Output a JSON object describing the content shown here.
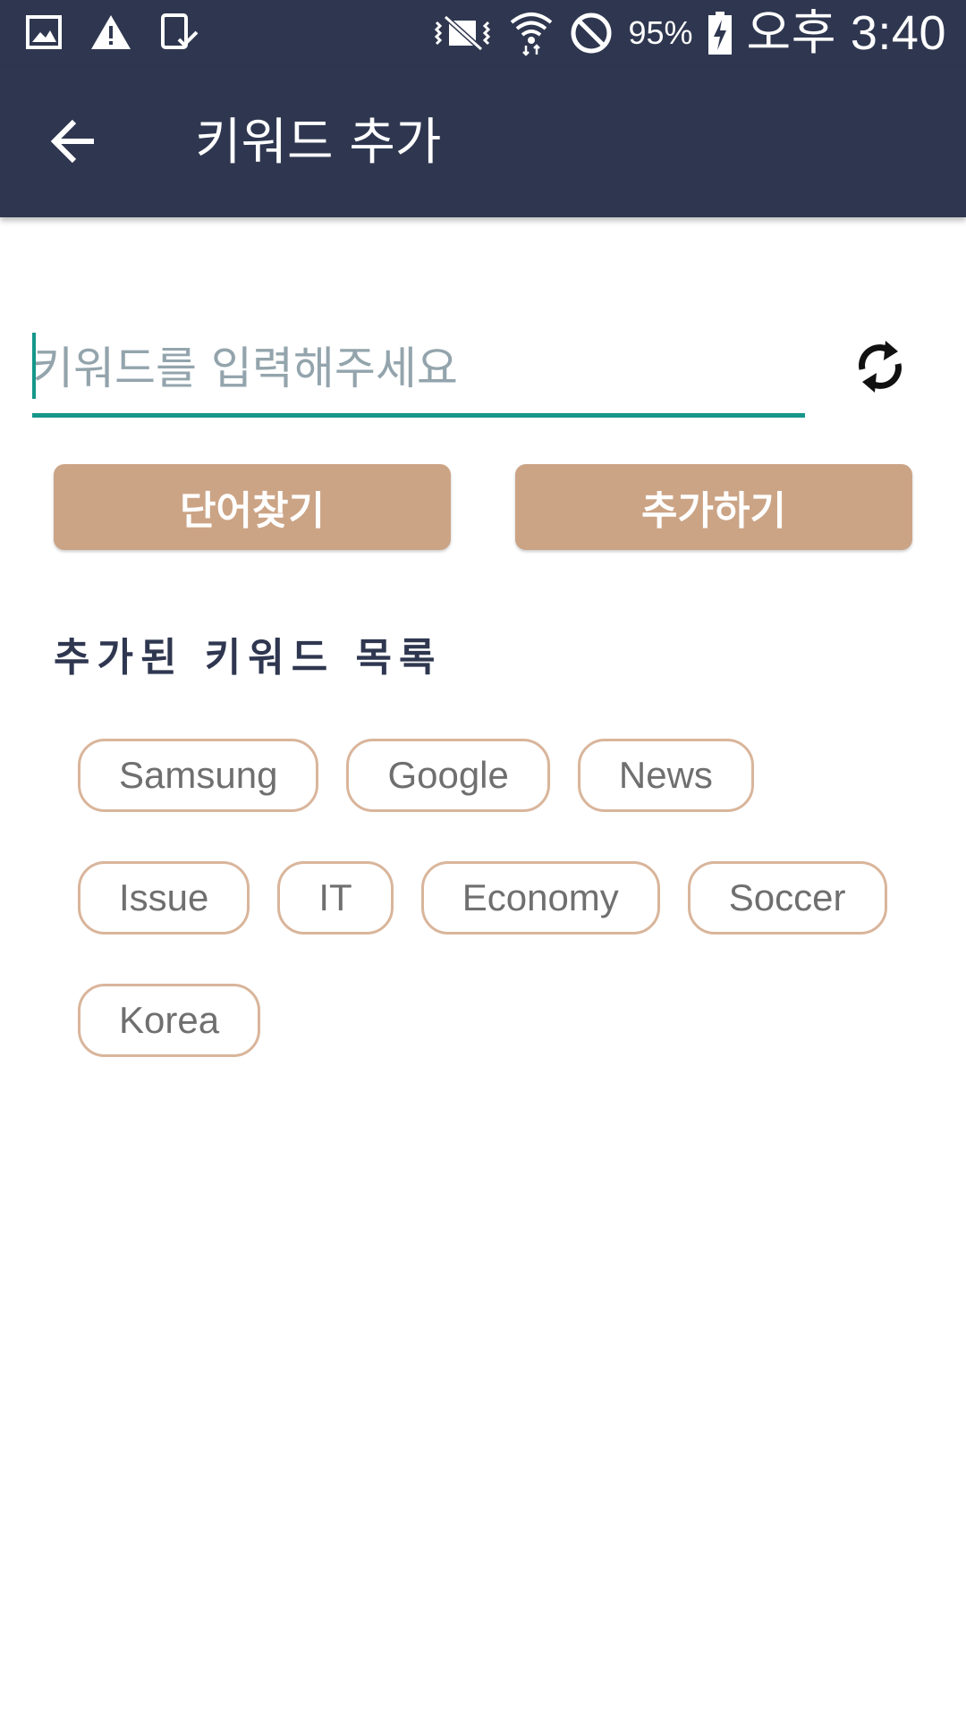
{
  "status_bar": {
    "battery": "95%",
    "ampm": "오후",
    "time": "3:40",
    "icons": [
      "image-icon",
      "warning-icon",
      "device-check-icon",
      "vibrate-icon",
      "wifi-icon",
      "do-not-disturb-icon",
      "battery-charging-icon"
    ]
  },
  "toolbar": {
    "title": "키워드 추가",
    "back_icon": "arrow-left-icon"
  },
  "keyword_input": {
    "placeholder": "키워드를 입력해주세요",
    "value": ""
  },
  "refresh_icon": "refresh-icon",
  "buttons": {
    "find_word": "단어찾기",
    "add": "추가하기"
  },
  "added_keywords": {
    "title": "추가된 키워드 목록",
    "items": [
      "Samsung",
      "Google",
      "News",
      "Issue",
      "IT",
      "Economy",
      "Soccer",
      "Korea"
    ]
  },
  "colors": {
    "header_bg": "#2f3750",
    "accent": "#16978a",
    "button_bg": "#cba486",
    "chip_border": "#d9b59b",
    "chip_text": "#6f6f6f",
    "placeholder": "#93a4ac"
  }
}
